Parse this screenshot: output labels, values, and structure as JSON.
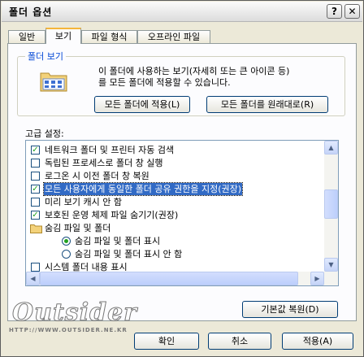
{
  "window": {
    "title": "폴더 옵션",
    "help_glyph": "?",
    "close_glyph": "✕"
  },
  "tabs": [
    {
      "label": "일반",
      "active": false
    },
    {
      "label": "보기",
      "active": true
    },
    {
      "label": "파일 형식",
      "active": false
    },
    {
      "label": "오프라인 파일",
      "active": false
    }
  ],
  "folder_view": {
    "legend": "폴더 보기",
    "description_line1": "이 폴더에 사용하는 보기(자세히 또는 큰 아이콘 등)",
    "description_line2": "를 모든 폴더에 적용할 수 있습니다.",
    "apply_button": "모든 폴더에 적용(L)",
    "reset_button": "모든 폴더를 원래대로(R)"
  },
  "advanced": {
    "label": "고급 설정:",
    "items": [
      {
        "type": "checkbox",
        "checked": true,
        "label": "네트워크 폴더 및 프린터 자동 검색"
      },
      {
        "type": "checkbox",
        "checked": false,
        "label": "독립된 프로세스로 폴더 창 실행"
      },
      {
        "type": "checkbox",
        "checked": false,
        "label": "로그온 시 이전 폴더 창 복원"
      },
      {
        "type": "checkbox",
        "checked": true,
        "label": "모든 사용자에게 동일한 폴더 공유 권한을 지정(권장)",
        "selected": true
      },
      {
        "type": "checkbox",
        "checked": false,
        "label": "미리 보기 캐시 안 함"
      },
      {
        "type": "checkbox",
        "checked": true,
        "label": "보호된 운영 체제 파일 숨기기(권장)"
      },
      {
        "type": "folder",
        "label": "숨김 파일 및 폴더"
      },
      {
        "type": "radio",
        "checked": true,
        "label": "숨김 파일 및 폴더 표시"
      },
      {
        "type": "radio",
        "checked": false,
        "label": "숨김 파일 및 폴더 표시 안 함"
      },
      {
        "type": "checkbox",
        "checked": false,
        "label": "시스템 폴더 내용 표시"
      }
    ],
    "restore_button": "기본값 복원(D)"
  },
  "watermark": {
    "text": "Outsider",
    "url": "HTTP://WWW.OUTSIDER.NE.KR"
  },
  "footer": {
    "ok": "확인",
    "cancel": "취소",
    "apply": "적용(A)"
  }
}
